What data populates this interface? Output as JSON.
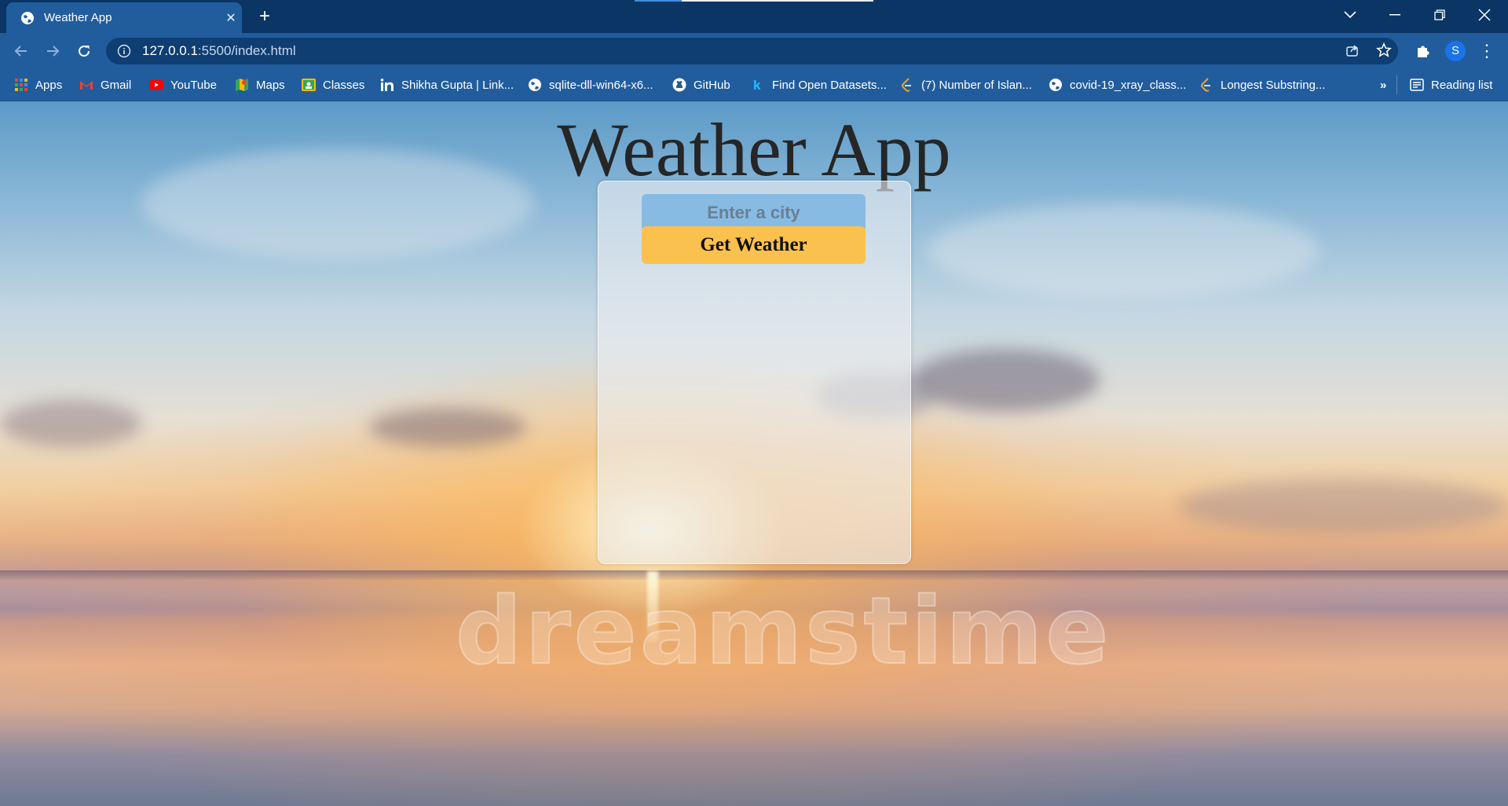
{
  "browser": {
    "tab_title": "Weather App",
    "url_host": "127.0.0.1",
    "url_path": ":5500/index.html",
    "avatar_letter": "S",
    "overflow_label": "»",
    "reading_list_label": "Reading list"
  },
  "bookmarks": [
    {
      "label": "Apps",
      "icon": "apps-grid-icon"
    },
    {
      "label": "Gmail",
      "icon": "gmail-icon"
    },
    {
      "label": "YouTube",
      "icon": "youtube-icon"
    },
    {
      "label": "Maps",
      "icon": "maps-icon"
    },
    {
      "label": "Classes",
      "icon": "classroom-icon"
    },
    {
      "label": "Shikha Gupta | Link...",
      "icon": "linkedin-icon"
    },
    {
      "label": "sqlite-dll-win64-x6...",
      "icon": "globe-icon"
    },
    {
      "label": "GitHub",
      "icon": "github-icon"
    },
    {
      "label": "Find Open Datasets...",
      "icon": "kaggle-icon"
    },
    {
      "label": "(7) Number of Islan...",
      "icon": "leetcode-icon"
    },
    {
      "label": "covid-19_xray_class...",
      "icon": "globe-icon"
    },
    {
      "label": "Longest Substring...",
      "icon": "leetcode-icon"
    }
  ],
  "page": {
    "title": "Weather App",
    "city_placeholder": "Enter a city",
    "button_label": "Get Weather",
    "watermark": "dreamstime"
  },
  "colors": {
    "chrome_dark": "#0a3565",
    "chrome_tab": "#215d9c",
    "input_bg": "#87bbe3",
    "button_bg": "#fbc14e"
  }
}
